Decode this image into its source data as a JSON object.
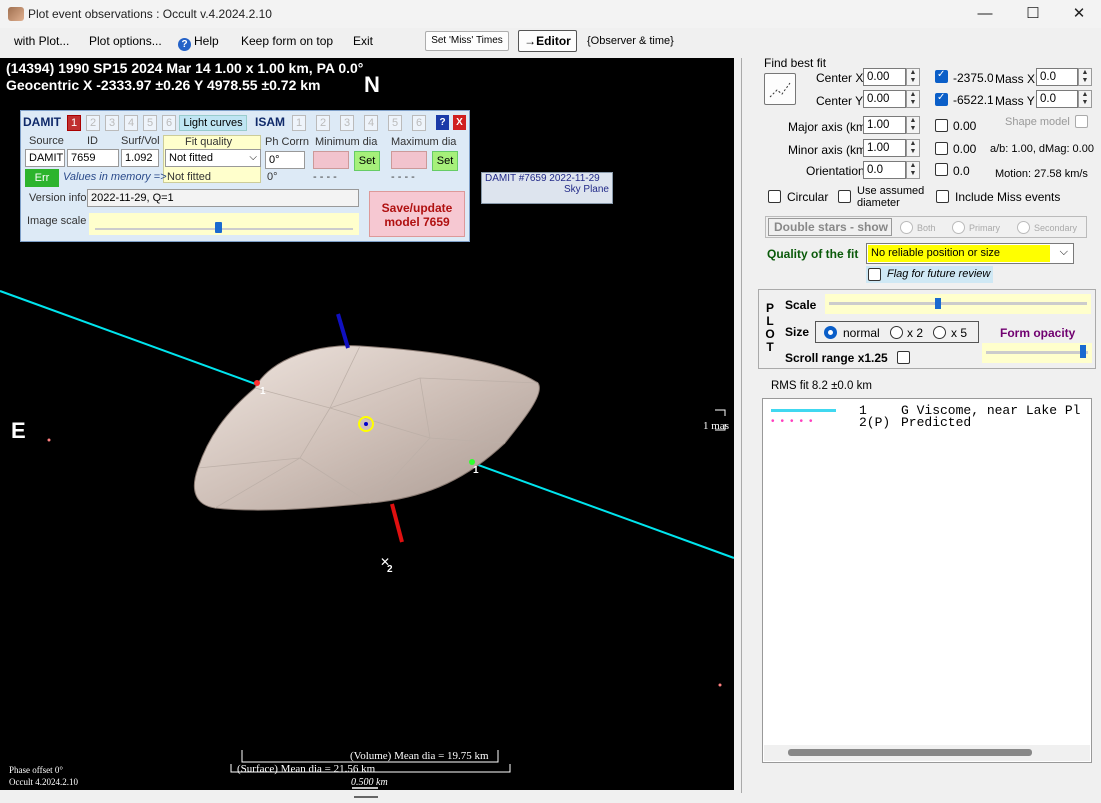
{
  "window": {
    "title": "Plot event observations : Occult v.4.2024.2.10",
    "min": "—",
    "max": "☐",
    "close": "✕"
  },
  "menu": {
    "with_plot": "with Plot...",
    "plot_options": "Plot options...",
    "help": "Help",
    "keep_on_top": "Keep form on top",
    "exit": "Exit",
    "set_miss": "Set 'Miss' Times",
    "editor": "→Editor",
    "observer_time": "{Observer & time}"
  },
  "plot": {
    "header_line1": "(14394) 1990 SP15  2024 Mar 14   1.00 x 1.00 km, PA 0.0°",
    "header_line2": "Geocentric  X  -2333.97 ±0.26  Y 4978.55 ±0.72 km",
    "north": "N",
    "east": "E",
    "mas_label": "1 mas",
    "damit_tag_line1": "DAMIT #7659 2022-11-29",
    "damit_tag_line2": "Sky Plane",
    "chord1_label": "1",
    "chord1b_label": "1",
    "point2_label": "2",
    "phase_offset": "Phase offset 0°",
    "version": "Occult 4.2024.2.10",
    "volume_dia": "(Volume) Mean dia = 19.75 km",
    "surface_dia": "(Surface) Mean dia = 21.56 km",
    "scale_bar": "0.500 km"
  },
  "damit": {
    "title": "DAMIT",
    "tabs": [
      "1",
      "2",
      "3",
      "4",
      "5",
      "6"
    ],
    "light_curves": "Light curves",
    "isam": "ISAM",
    "isam_tabs": [
      "1",
      "2",
      "3",
      "4",
      "5",
      "6"
    ],
    "help_q": "?",
    "close_x": "X",
    "source_hdr": "Source",
    "id_hdr": "ID",
    "surfvol_hdr": "Surf/Vol",
    "source_val": "DAMIT",
    "id_val": "7659",
    "surfvol_val": "1.092",
    "fit_quality_hdr": "Fit quality",
    "fit_quality_val": "Not fitted",
    "fit_quality_mem": "Not fitted",
    "ph_corr_hdr": "Ph Corrn",
    "ph_corr_val": "0°",
    "ph_corr_mem": "0°",
    "min_dia_hdr": "Minimum dia",
    "min_dia_mem": "- - - -",
    "max_dia_hdr": "Maximum dia",
    "max_dia_mem": "- - - -",
    "set1": "Set",
    "set2": "Set",
    "err": "Err",
    "values_in_memory": "Values in memory =>",
    "version_info_lbl": "Version info",
    "version_info_val": "2022-11-29, Q=1",
    "image_scale_lbl": "Image scale",
    "save_btn_l1": "Save/update",
    "save_btn_l2": "model  7659"
  },
  "fit": {
    "find_best_fit": "Find best fit",
    "center_x_lbl": "Center X",
    "center_x_val": "0.00",
    "center_y_lbl": "Center Y",
    "center_y_val": "0.00",
    "cx_result": "-2375.03",
    "cy_result": "-6522.13",
    "mass_x_lbl": "Mass X",
    "mass_x_val": "0.0",
    "mass_y_lbl": "Mass Y",
    "mass_y_val": "0.0",
    "major_lbl": "Major axis (km)",
    "major_val": "1.00",
    "major_res": "0.00",
    "minor_lbl": "Minor axis (km)",
    "minor_val": "1.00",
    "minor_res": "0.00",
    "orient_lbl": "Orientation",
    "orient_val": "0.0",
    "orient_res": "0.0",
    "shape_model": "Shape model",
    "ab_text": "a/b: 1.00, dMag: 0.00",
    "motion": "Motion: 27.58 km/s",
    "circular": "Circular",
    "use_assumed_1": "Use assumed",
    "use_assumed_2": "diameter",
    "include_miss": "Include Miss events",
    "double_stars": "Double stars - show",
    "both": "Both",
    "primary": "Primary",
    "secondary": "Secondary",
    "quality_lbl": "Quality of the fit",
    "quality_val": "No reliable position or size",
    "flag_review": "Flag for future review"
  },
  "plotctl": {
    "side_letters": [
      "P",
      "L",
      "O",
      "T"
    ],
    "scale": "Scale",
    "size": "Size",
    "normal": "normal",
    "x2": "x 2",
    "x5": "x 5",
    "form_opacity": "Form opacity",
    "scroll_range": "Scroll range x1.25"
  },
  "results": {
    "rms": "RMS fit 8.2 ±0.0 km",
    "line1_num": "1",
    "line1_text": "G Viscome, near Lake Pl",
    "line2_num": "2(P)",
    "line2_text": "Predicted"
  },
  "colors": {
    "chord_line": "#00e5ee",
    "axis_blue": "#1010c0",
    "axis_red": "#e01010",
    "yellow": "#ffff00"
  },
  "icons": [
    "app-icon",
    "help-icon",
    "chevron-down-icon",
    "minimize-icon",
    "maximize-icon",
    "close-icon",
    "fit-graph-icon"
  ]
}
